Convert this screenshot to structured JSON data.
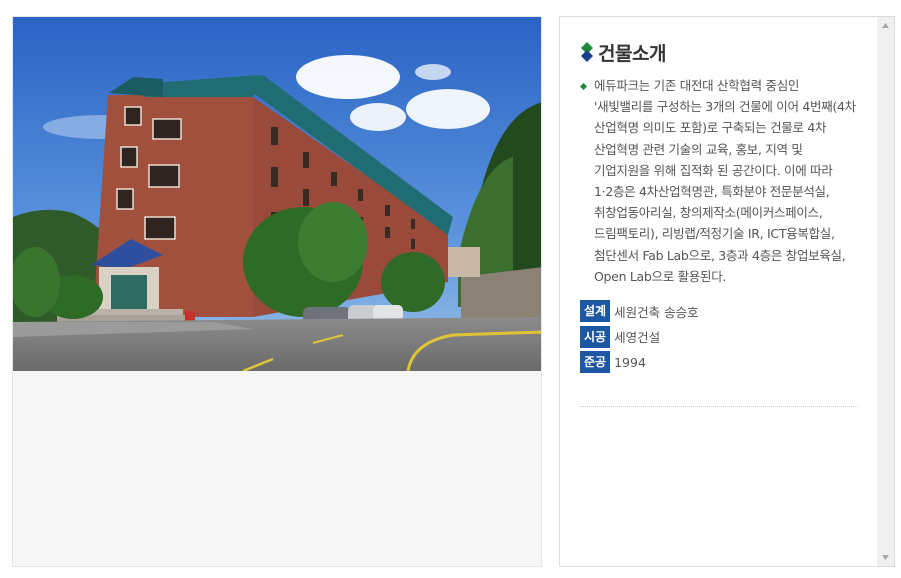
{
  "building": {
    "title": "건물소개",
    "description": "에듀파크는 기존 대전대 산학협력 중심인 '새빛밸리를 구성하는 3개의 건물에 이어 4번째(4차 산업혁명 의미도 포함)로 구축되는 건물로 4차 산업혁명 관련 기술의 교육, 홍보, 지역 및 기업지원을 위해 집적화 된 공간이다. 이에 따라 1·2층은 4차산업혁명관, 특화분야 전문분석실, 취창업동아리실, 창의제작소(메이커스페이스, 드림팩토리), 리빙랩/적정기술 IR, ICT융복합실, 첨단센서 Fab Lab으로, 3층과 4층은 창업보육실, Open Lab으로 활용된다.",
    "credits": [
      {
        "label": "설계",
        "value": "세원건축 송승호"
      },
      {
        "label": "시공",
        "value": "세영건설"
      },
      {
        "label": "준공",
        "value": "1994"
      }
    ]
  },
  "colors": {
    "accent_blue": "#1b57a3",
    "accent_green": "#1d8a3a"
  },
  "icons": {
    "title": "diamond-stack-icon",
    "bullet": "diamond-bullet-icon",
    "scroll_up": "scroll-up-arrow-icon",
    "scroll_down": "scroll-down-arrow-icon"
  }
}
